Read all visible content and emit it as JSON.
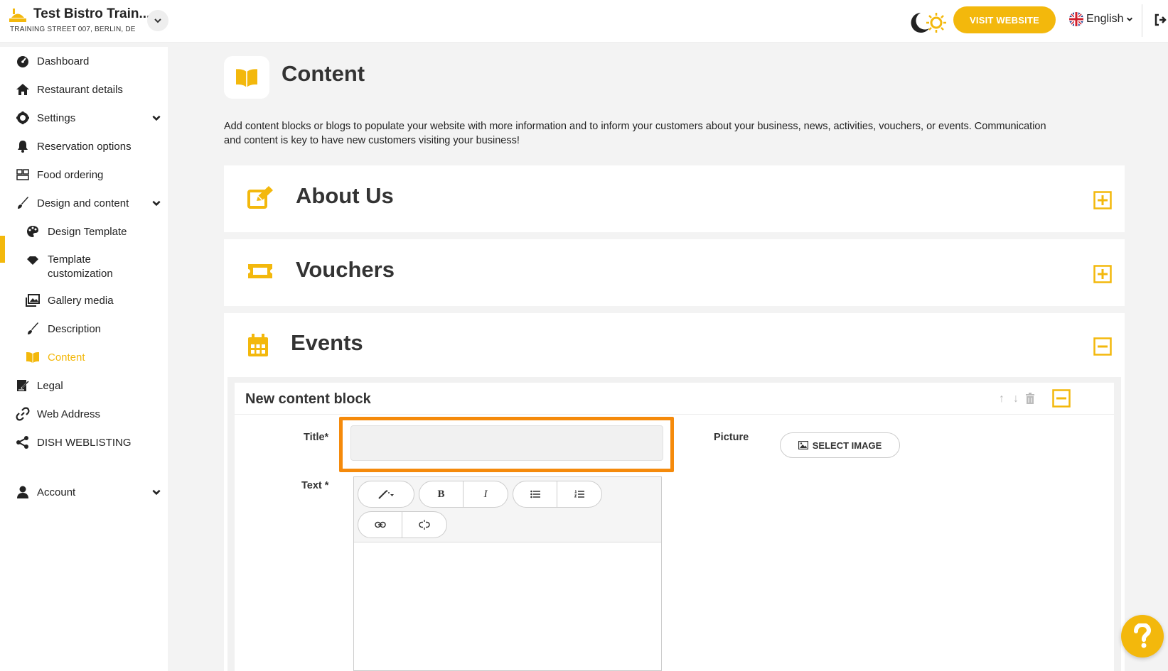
{
  "header": {
    "restaurant_name": "Test Bistro Train...",
    "restaurant_address": "TRAINING STREET 007, BERLIN, DE",
    "visit_website_label": "VISIT WEBSITE",
    "language_label": "English"
  },
  "sidebar": {
    "items": [
      {
        "label": "Dashboard"
      },
      {
        "label": "Restaurant details"
      },
      {
        "label": "Settings"
      },
      {
        "label": "Reservation options"
      },
      {
        "label": "Food ordering"
      },
      {
        "label": "Design and content"
      },
      {
        "label": "Design Template"
      },
      {
        "label": "Template customization"
      },
      {
        "label": "Gallery media"
      },
      {
        "label": "Description"
      },
      {
        "label": "Content"
      },
      {
        "label": "Legal"
      },
      {
        "label": "Web Address"
      },
      {
        "label": "DISH WEBLISTING"
      },
      {
        "label": "Account"
      }
    ]
  },
  "main": {
    "title": "Content",
    "description": "Add content blocks or blogs to populate your website with more information and to inform your customers about your business, news, activities, vouchers, or events. Communication and content is key to have new customers visiting your business!",
    "sections": [
      {
        "title": "About Us",
        "expanded": false
      },
      {
        "title": "Vouchers",
        "expanded": false
      },
      {
        "title": "Events",
        "expanded": true
      }
    ],
    "content_block": {
      "heading": "New content block",
      "title_label": "Title*",
      "title_value": "",
      "text_label": "Text *",
      "picture_label": "Picture",
      "select_image_label": "SELECT IMAGE"
    }
  },
  "colors": {
    "accent": "#f3b80c",
    "highlight": "#f58a0b"
  }
}
